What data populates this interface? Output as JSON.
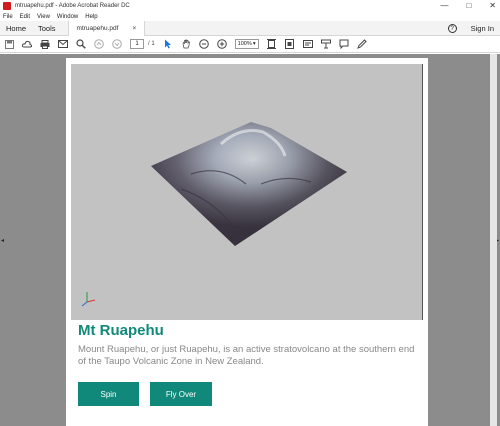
{
  "window": {
    "title": "mtruapehu.pdf - Adobe Acrobat Reader DC",
    "minimize_glyph": "—",
    "maximize_glyph": "□",
    "close_glyph": "✕"
  },
  "menu": [
    "File",
    "Edit",
    "View",
    "Window",
    "Help"
  ],
  "tabs": {
    "home": "Home",
    "tools": "Tools",
    "document": "mtruapehu.pdf",
    "document_close": "×",
    "help_glyph": "?",
    "sign_in": "Sign In"
  },
  "toolbar": {
    "page_current": "1",
    "page_total": "/ 1",
    "zoom": "100%"
  },
  "nav": {
    "left_arrow": "◂",
    "right_arrow": "▸"
  },
  "document": {
    "heading": "Mt Ruapehu",
    "description": "Mount Ruapehu, or just Ruapehu, is an active stratovolcano at the southern end of the Taupo Volcanic Zone in New Zealand.",
    "buttons": {
      "spin": "Spin",
      "fly_over": "Fly Over"
    }
  },
  "colors": {
    "accent": "#11897a",
    "viewport_bg": "#c2c2c2",
    "viewer_bg": "#8c8c8c"
  }
}
